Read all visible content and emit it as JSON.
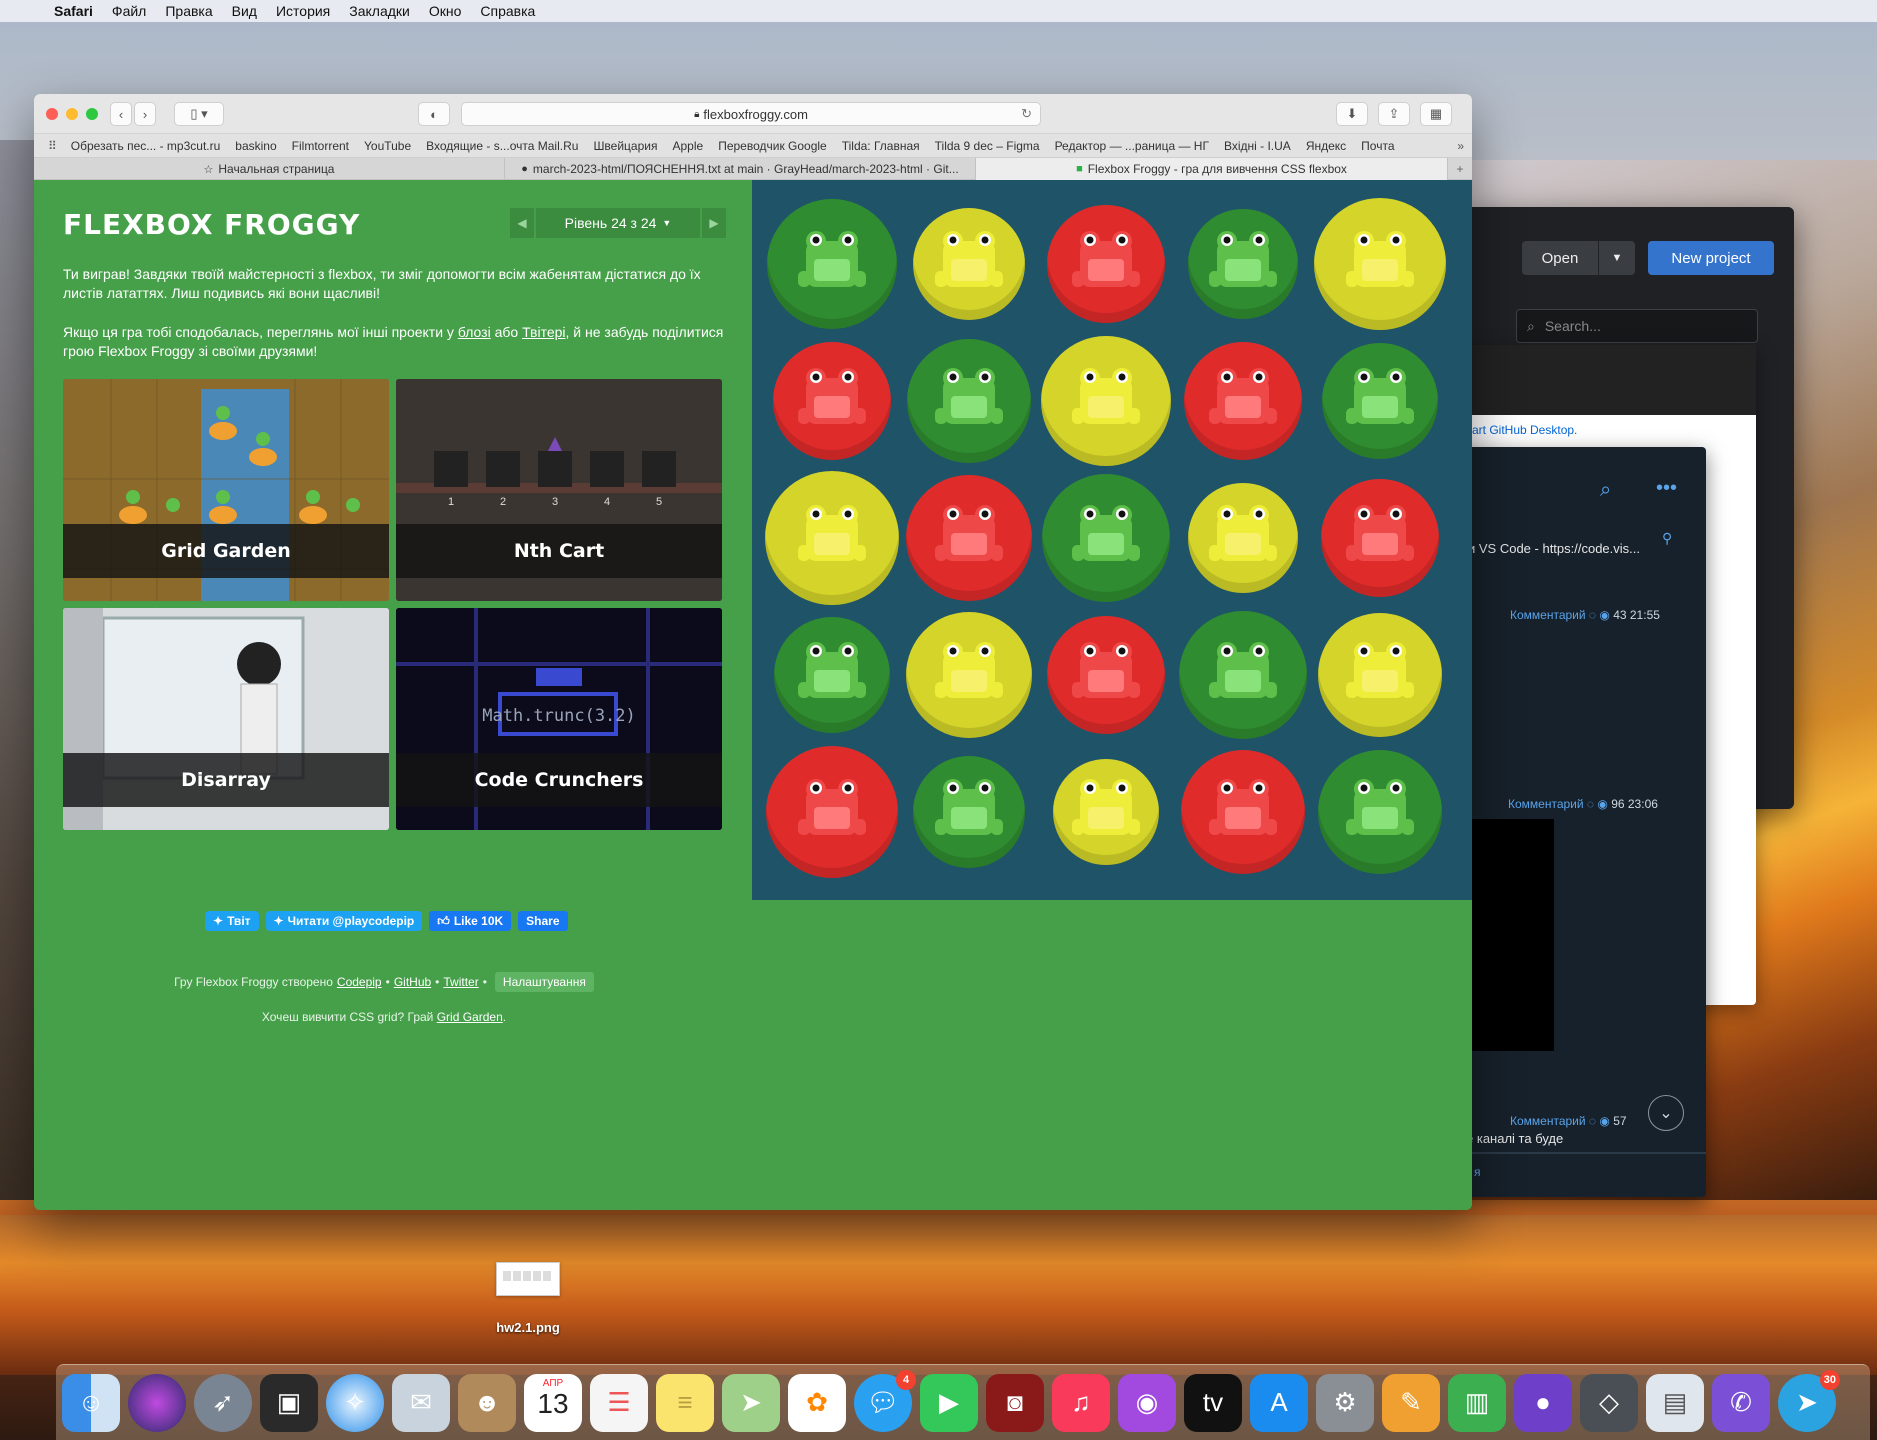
{
  "menubar": {
    "app": "Safari",
    "items": [
      "Файл",
      "Правка",
      "Вид",
      "История",
      "Закладки",
      "Окно",
      "Справка"
    ]
  },
  "safari": {
    "url": "flexboxfroggy.com",
    "favorites": [
      "Обрезать пес... - mp3cut.ru",
      "baskino",
      "Filmtorrent",
      "YouTube",
      "Входящие - s...очта Mail.Ru",
      "Швейцария",
      "Apple",
      "Переводчик Google",
      "Tilda: Главная",
      "Tilda 9 dec – Figma",
      "Редактор — ...раница — НГ",
      "Вхідні - I.UA",
      "Яндекс",
      "Почта"
    ],
    "tabs": [
      {
        "label": "Начальная страница",
        "icon": "star-icon"
      },
      {
        "label": "march-2023-html/ПОЯСНЕННЯ.txt at main · GrayHead/march-2023-html · Git...",
        "icon": "github-icon"
      },
      {
        "label": "Flexbox Froggy - гра для вивчення CSS flexbox",
        "icon": "frog-icon"
      }
    ]
  },
  "froggy": {
    "title": "FLEXBOX FROGGY",
    "level": "Рівень 24 з 24",
    "win_text": "Ти виграв! Завдяки твоїй майстерності з flexbox, ти зміг допомогти всім жабенятам дістатися до їх листів лататтях. Лиш подивись які вони щасливі!",
    "share_pre": "Якщо ця гра тобі сподобалась, переглянь мої інші проекти у ",
    "blog_link": "блозі",
    "share_mid": " або ",
    "twitter_link": "Твітері",
    "share_post": ", й не забудь поділитися грою Flexbox Froggy зі своїми друзями!",
    "projects": [
      "Grid Garden",
      "Nth Cart",
      "Disarray",
      "Code Crunchers"
    ],
    "cart_numbers": [
      "1",
      "2",
      "3",
      "4",
      "5"
    ],
    "code_text": "Math.trunc(3.2)",
    "social": {
      "tweet": "Твіт",
      "follow": "Читати @playcodepip",
      "like": "Like 10K",
      "share": "Share"
    },
    "footer": {
      "created": "Гру Flexbox Froggy створено",
      "codepip": "Codepip",
      "github": "GitHub",
      "twitter": "Twitter",
      "settings": "Налаштування",
      "grid_q": "Хочеш вивчити CSS grid? Грай",
      "grid_link": "Grid Garden",
      "grid_end": "."
    },
    "pond_colors": {
      "green": "#2f8c30",
      "yellow": "#d4d42a",
      "red": "#e02b2b"
    },
    "pond": [
      [
        "green",
        "yellow",
        "red",
        "green",
        "yellow"
      ],
      [
        "red",
        "green",
        "yellow",
        "red",
        "green"
      ],
      [
        "yellow",
        "red",
        "green",
        "yellow",
        "red"
      ],
      [
        "green",
        "yellow",
        "red",
        "green",
        "yellow"
      ],
      [
        "red",
        "green",
        "yellow",
        "red",
        "green"
      ]
    ]
  },
  "bg_windows": {
    "open": "Open",
    "new_project": "New project",
    "search": "Search...",
    "github_desktop": "art GitHub Desktop.",
    "tg_pinned": "и VS Code - https://code.vis...",
    "tg_comment": "Комментарий",
    "tg_meta1": "43 21:55",
    "tg_meta2": "96 23:06",
    "tg_meta3": "57",
    "tg_text": "е каналі та буде",
    "tg_link": "я"
  },
  "desktop": {
    "file": "hw2.1.png"
  },
  "dock": {
    "calendar_month": "АПР",
    "calendar_day": "13",
    "messages_badge": "4",
    "telegram_badge": "30",
    "apps": [
      "finder-icon",
      "siri-icon",
      "launchpad-icon",
      "photo-booth-icon",
      "safari-icon",
      "mail-icon",
      "contacts-icon",
      "calendar-icon",
      "reminders-icon",
      "notes-icon",
      "maps-icon",
      "photos-icon",
      "messages-icon",
      "facetime-icon",
      "photo-booth2-icon",
      "music-icon",
      "podcasts-icon",
      "appletv-icon",
      "appstore-icon",
      "system-preferences-icon",
      "pages-icon",
      "numbers-icon",
      "github-desktop-icon",
      "unity-icon",
      "preview-icon",
      "viber-icon",
      "telegram-icon"
    ]
  }
}
